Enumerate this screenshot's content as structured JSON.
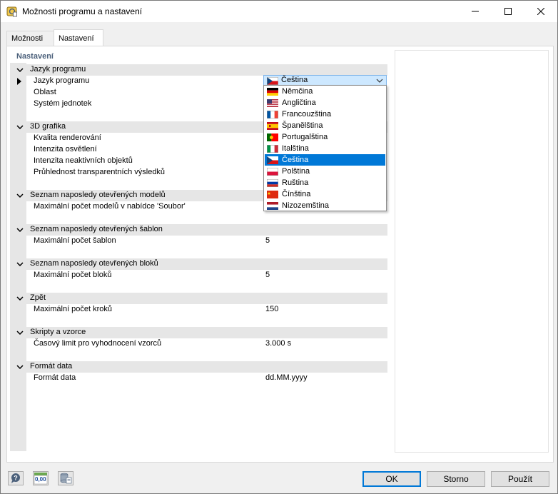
{
  "window": {
    "title": "Možnosti programu a nastavení"
  },
  "tabs": [
    {
      "label": "Možnosti",
      "active": false
    },
    {
      "label": "Nastavení",
      "active": true
    }
  ],
  "panel": {
    "title": "Nastavení"
  },
  "groups": {
    "language": {
      "label": "Jazyk programu",
      "items": [
        {
          "label": "Jazyk programu",
          "value": "Čeština"
        },
        {
          "label": "Oblast",
          "value": ""
        },
        {
          "label": "Systém jednotek",
          "value": ""
        }
      ]
    },
    "graphics": {
      "label": "3D grafika",
      "items": [
        {
          "label": "Kvalita renderování",
          "value": ""
        },
        {
          "label": "Intenzita osvětlení",
          "value": ""
        },
        {
          "label": "Intenzita neaktivních objektů",
          "value": ""
        },
        {
          "label": "Průhlednost transparentních výsledků",
          "value": ""
        }
      ]
    },
    "recent_models": {
      "label": "Seznam naposledy otevřených modelů",
      "items": [
        {
          "label": "Maximální počet modelů v nabídce 'Soubor'",
          "value": ""
        }
      ]
    },
    "recent_templates": {
      "label": "Seznam naposledy otevřených šablon",
      "items": [
        {
          "label": "Maximální počet šablon",
          "value": "5"
        }
      ]
    },
    "recent_blocks": {
      "label": "Seznam naposledy otevřených bloků",
      "items": [
        {
          "label": "Maximální počet bloků",
          "value": "5"
        }
      ]
    },
    "undo": {
      "label": "Zpět",
      "items": [
        {
          "label": "Maximální počet kroků",
          "value": "150"
        }
      ]
    },
    "scripts": {
      "label": "Skripty a vzorce",
      "items": [
        {
          "label": "Časový limit pro vyhodnocení vzorců",
          "value": "3.000 s"
        }
      ]
    },
    "date_format": {
      "label": "Formát data",
      "items": [
        {
          "label": "Formát data",
          "value": "dd.MM.yyyy"
        }
      ]
    }
  },
  "language_dropdown": {
    "selected": "Čeština",
    "options": [
      {
        "label": "Němčina",
        "flag": "de-flag-icon"
      },
      {
        "label": "Angličtina",
        "flag": "us-flag-icon"
      },
      {
        "label": "Francouzština",
        "flag": "fr-flag-icon"
      },
      {
        "label": "Španělština",
        "flag": "es-flag-icon"
      },
      {
        "label": "Portugalština",
        "flag": "pt-flag-icon"
      },
      {
        "label": "Italština",
        "flag": "it-flag-icon"
      },
      {
        "label": "Čeština",
        "flag": "cz-flag-icon",
        "selected": true
      },
      {
        "label": "Polština",
        "flag": "pl-flag-icon"
      },
      {
        "label": "Ruština",
        "flag": "ru-flag-icon"
      },
      {
        "label": "Čínština",
        "flag": "cn-flag-icon"
      },
      {
        "label": "Nizozemština",
        "flag": "nl-flag-icon"
      }
    ]
  },
  "footer": {
    "icons": [
      "help-icon",
      "units-icon",
      "database-icon"
    ],
    "units_icon_text": "0,00",
    "ok_label": "OK",
    "cancel_label": "Storno",
    "apply_label": "Použít"
  },
  "colors": {
    "selection": "#0078d7",
    "combo_bg": "#cde8ff",
    "group_bg": "#e6e6e6",
    "panel_title": "#4a5f7a"
  }
}
